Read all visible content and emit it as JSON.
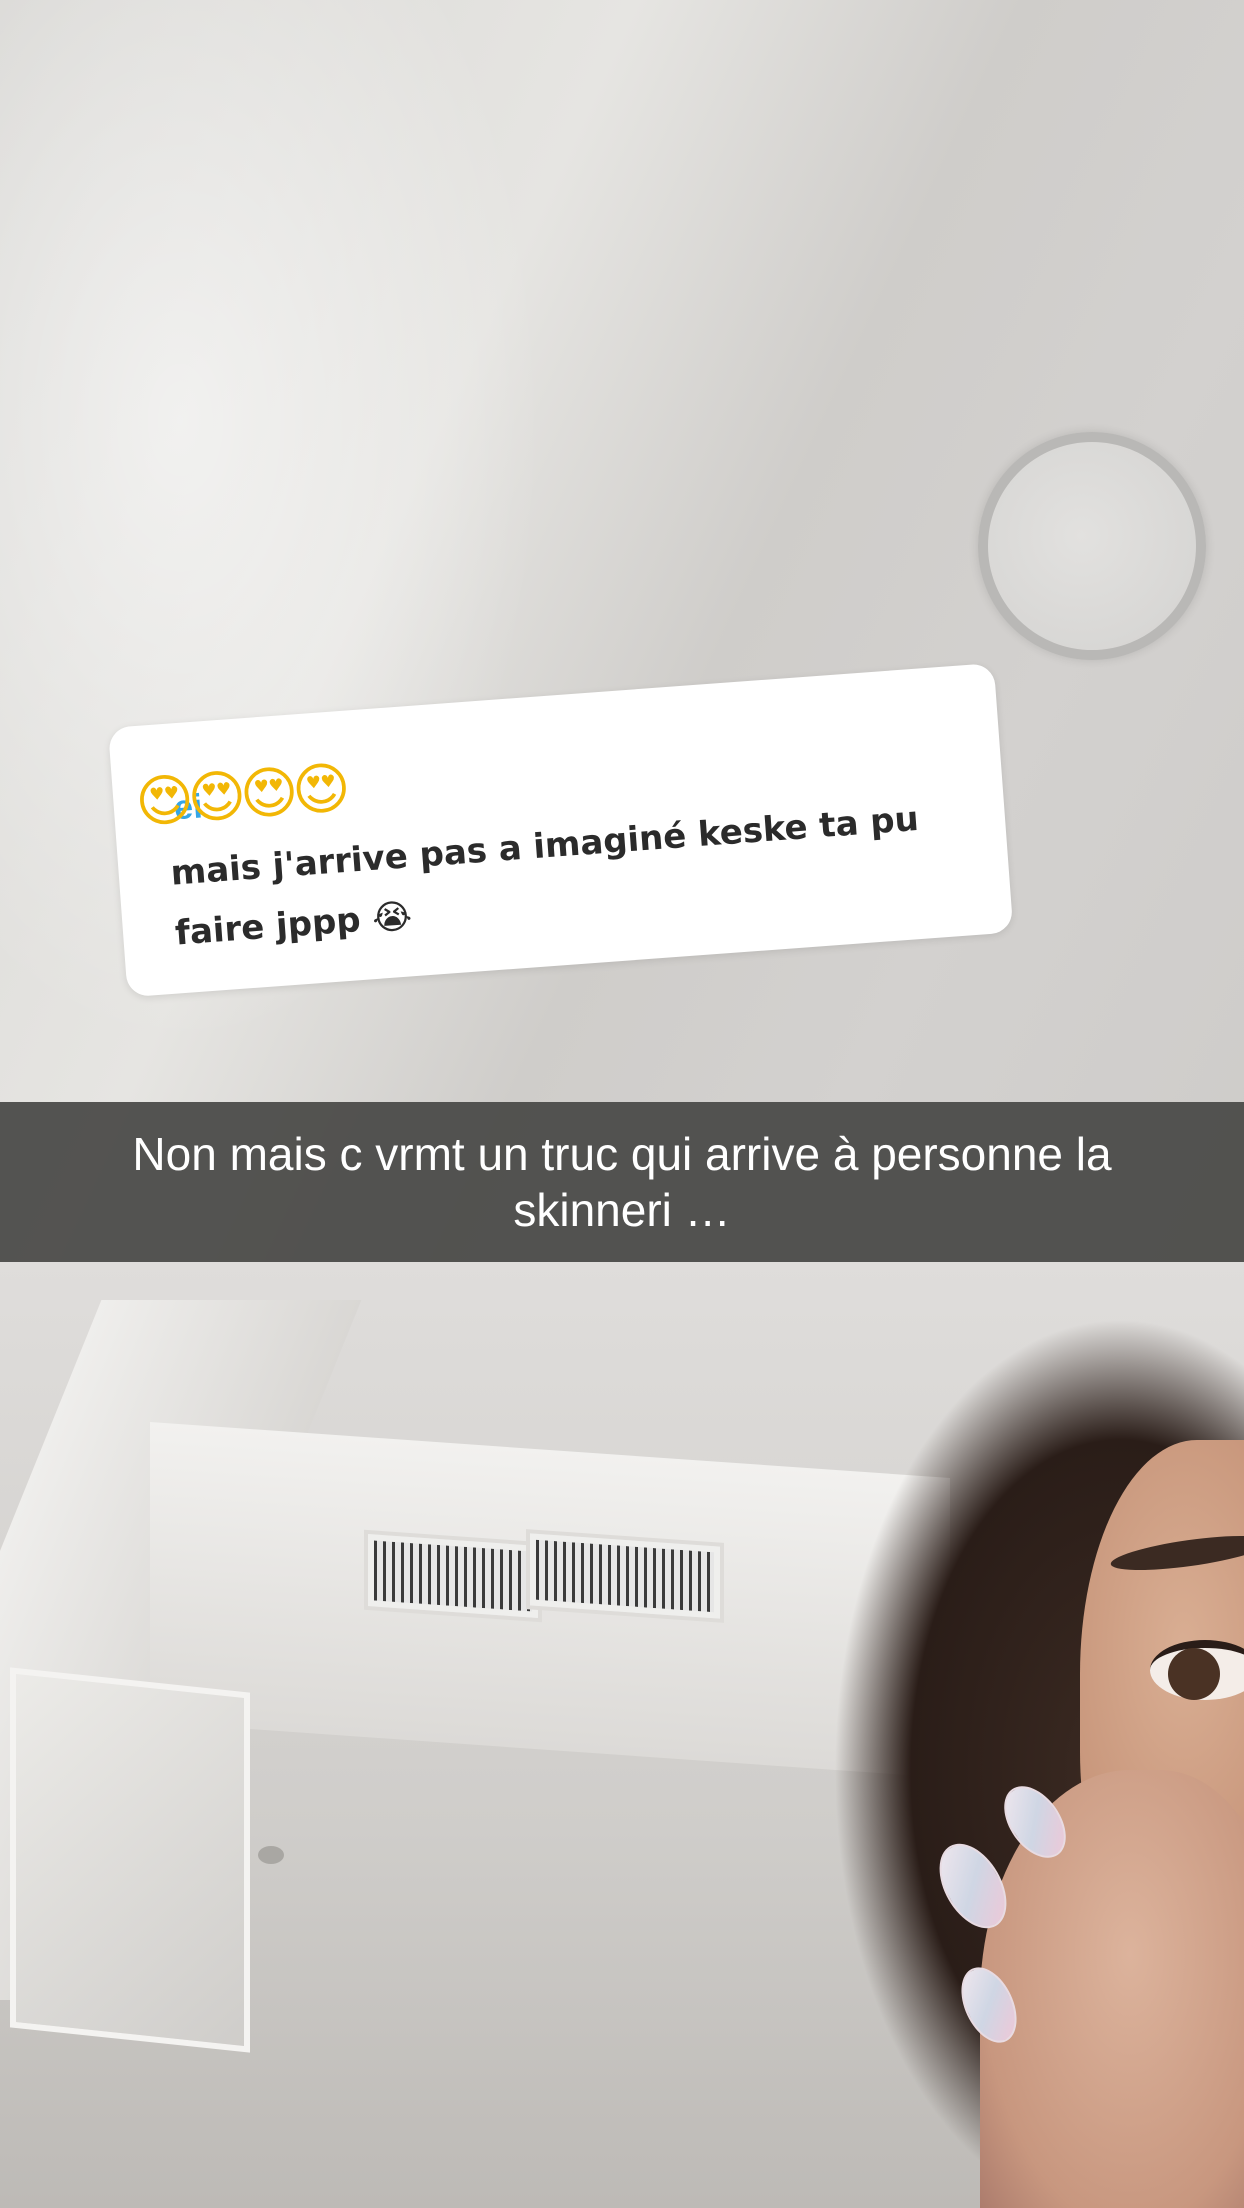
{
  "sticker": {
    "handle": "ei",
    "emojis": "😍😍😍😍",
    "message": "mais j'arrive pas a imaginé keske ta pu faire jppp 😭"
  },
  "caption": {
    "text": "Non mais c vrmt un truc qui arrive à personne la skinneri …"
  },
  "colors": {
    "caption_bg": "#484846",
    "sticker_bg": "#ffffff",
    "sticker_text": "#2b2b2b"
  }
}
